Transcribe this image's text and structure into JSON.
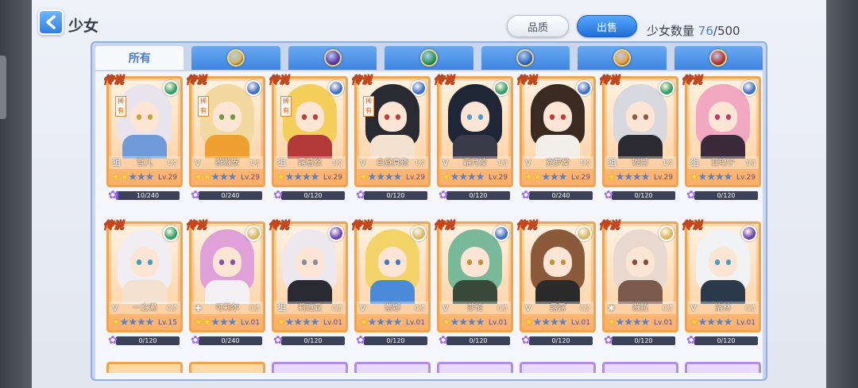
{
  "header": {
    "title": "少女",
    "quality_button": "品质",
    "sell_button": "出售",
    "count_label": "少女数量",
    "count_current": "76",
    "count_total": "/500"
  },
  "tabs": [
    {
      "label": "所有",
      "icon": "all-tab",
      "active": true
    },
    {
      "label": "",
      "icon": "gold-emblem-icon",
      "color": "#d9b45a"
    },
    {
      "label": "",
      "icon": "purple-emblem-icon",
      "color": "#6b3fb0"
    },
    {
      "label": "",
      "icon": "green-swirl-icon",
      "color": "#2f9e5e"
    },
    {
      "label": "",
      "icon": "blue-emblem-icon",
      "color": "#3b6fc8"
    },
    {
      "label": "",
      "icon": "orange-star-icon",
      "color": "#f0a040"
    },
    {
      "label": "",
      "icon": "red-emblem-icon",
      "color": "#c83a3a"
    }
  ],
  "badge_legend": "传说",
  "badge_rare": "稀有",
  "cards": [
    {
      "name": "雪儿",
      "grade": "1阶",
      "lv": "Lv.29",
      "stars": 2,
      "exp": "10/240",
      "exp_ratio": 0.04,
      "rare": true,
      "attr": "#2f9e5e",
      "hair": "#e8e4ee",
      "eye": "#c8a23a",
      "outfit": "#6f9bd8",
      "klass": "狙"
    },
    {
      "name": "薇薇安",
      "grade": "1阶",
      "lv": "Lv.29",
      "stars": 2,
      "exp": "0/240",
      "exp_ratio": 0,
      "rare": true,
      "attr": "#3b6fc8",
      "hair": "#f2d9a0",
      "eye": "#6d9a3a",
      "outfit": "#f0a030",
      "klass": "V"
    },
    {
      "name": "露易丝",
      "grade": "1阶",
      "lv": "Lv.29",
      "stars": 1,
      "exp": "0/120",
      "exp_ratio": 0,
      "rare": true,
      "attr": "#3b6fc8",
      "hair": "#f4cf5a",
      "eye": "#c23a3a",
      "outfit": "#b43a3a",
      "klass": "狙"
    },
    {
      "name": "白昼真夜",
      "grade": "1阶",
      "lv": "Lv.29",
      "stars": 1,
      "exp": "0/120",
      "exp_ratio": 0,
      "rare": true,
      "attr": "#3b6fc8",
      "hair": "#2a2a33",
      "eye": "#c23a3a",
      "outfit": "#f3e2d0",
      "klass": "V"
    },
    {
      "name": "霜月凌",
      "grade": "1阶",
      "lv": "Lv.29",
      "stars": 1,
      "exp": "0/120",
      "exp_ratio": 0,
      "rare": false,
      "attr": "#2f9e5e",
      "hair": "#1f2636",
      "eye": "#4aa0c8",
      "outfit": "#3a3a48",
      "klass": "V"
    },
    {
      "name": "克萝爱",
      "grade": "1阶",
      "lv": "Lv.29",
      "stars": 2,
      "exp": "0/240",
      "exp_ratio": 0,
      "rare": false,
      "attr": "#3b6fc8",
      "hair": "#3a2a22",
      "eye": "#c23a3a",
      "outfit": "#f2efe8",
      "klass": "V"
    },
    {
      "name": "妮娜",
      "grade": "1阶",
      "lv": "Lv.29",
      "stars": 1,
      "exp": "0/120",
      "exp_ratio": 0,
      "rare": false,
      "attr": "#2f9e5e",
      "hair": "#d8d8df",
      "eye": "#8a5a3a",
      "outfit": "#2a2a30",
      "klass": "狙"
    },
    {
      "name": "亚璃子",
      "grade": "1阶",
      "lv": "Lv.29",
      "stars": 1,
      "exp": "0/120",
      "exp_ratio": 0,
      "rare": false,
      "attr": "#3b6fc8",
      "hair": "#f2a8c0",
      "eye": "#c23a6a",
      "outfit": "#3a2a3a",
      "klass": "狙"
    },
    {
      "name": "一之濑",
      "grade": "0阶",
      "lv": "Lv.15",
      "stars": 1,
      "exp": "0/120",
      "exp_ratio": 0,
      "rare": false,
      "attr": "#2f9e5e",
      "hair": "#f0eef2",
      "eye": "#3aa0c8",
      "outfit": "#f3e2d0",
      "klass": "V"
    },
    {
      "name": "可莉尔",
      "grade": "0阶",
      "lv": "Lv.01",
      "stars": 2,
      "exp": "0/240",
      "exp_ratio": 0,
      "rare": false,
      "attr": "#d9b45a",
      "hair": "#e0a0d8",
      "eye": "#8a4ab0",
      "outfit": "#f2f0f4",
      "klass": "✚"
    },
    {
      "name": "莉迪亚",
      "grade": "0阶",
      "lv": "Lv.01",
      "stars": 1,
      "exp": "0/120",
      "exp_ratio": 0,
      "rare": false,
      "attr": "#6b3fb0",
      "hair": "#ece8ee",
      "eye": "#8a8a9a",
      "outfit": "#2a2a33",
      "klass": "狙"
    },
    {
      "name": "蕾娜",
      "grade": "0阶",
      "lv": "Lv.01",
      "stars": 1,
      "exp": "0/120",
      "exp_ratio": 0,
      "rare": false,
      "attr": "#d9b45a",
      "hair": "#f4d468",
      "eye": "#3a7ac8",
      "outfit": "#4a8ad8",
      "klass": "V"
    },
    {
      "name": "莎伦",
      "grade": "0阶",
      "lv": "Lv.01",
      "stars": 1,
      "exp": "0/120",
      "exp_ratio": 0,
      "rare": false,
      "attr": "#3b6fc8",
      "hair": "#7ab89a",
      "eye": "#c8902a",
      "outfit": "#3a4a3a",
      "klass": "V"
    },
    {
      "name": "露露",
      "grade": "0阶",
      "lv": "Lv.01",
      "stars": 1,
      "exp": "0/120",
      "exp_ratio": 0,
      "rare": false,
      "attr": "#d9b45a",
      "hair": "#8a5a3a",
      "eye": "#c8902a",
      "outfit": "#2a2a2a",
      "klass": "V"
    },
    {
      "name": "薇拉",
      "grade": "0阶",
      "lv": "Lv.01",
      "stars": 1,
      "exp": "0/120",
      "exp_ratio": 0,
      "rare": false,
      "attr": "#d9b45a",
      "hair": "#e8d8d0",
      "eye": "#8a4a3a",
      "outfit": "#7a5a4a",
      "klass": "✱"
    },
    {
      "name": "洛林",
      "grade": "0阶",
      "lv": "Lv.01",
      "stars": 1,
      "exp": "0/120",
      "exp_ratio": 0,
      "rare": false,
      "attr": "#6b3fb0",
      "hair": "#f0f2f4",
      "eye": "#3aa0c8",
      "outfit": "#2a3a4a",
      "klass": "V"
    }
  ]
}
